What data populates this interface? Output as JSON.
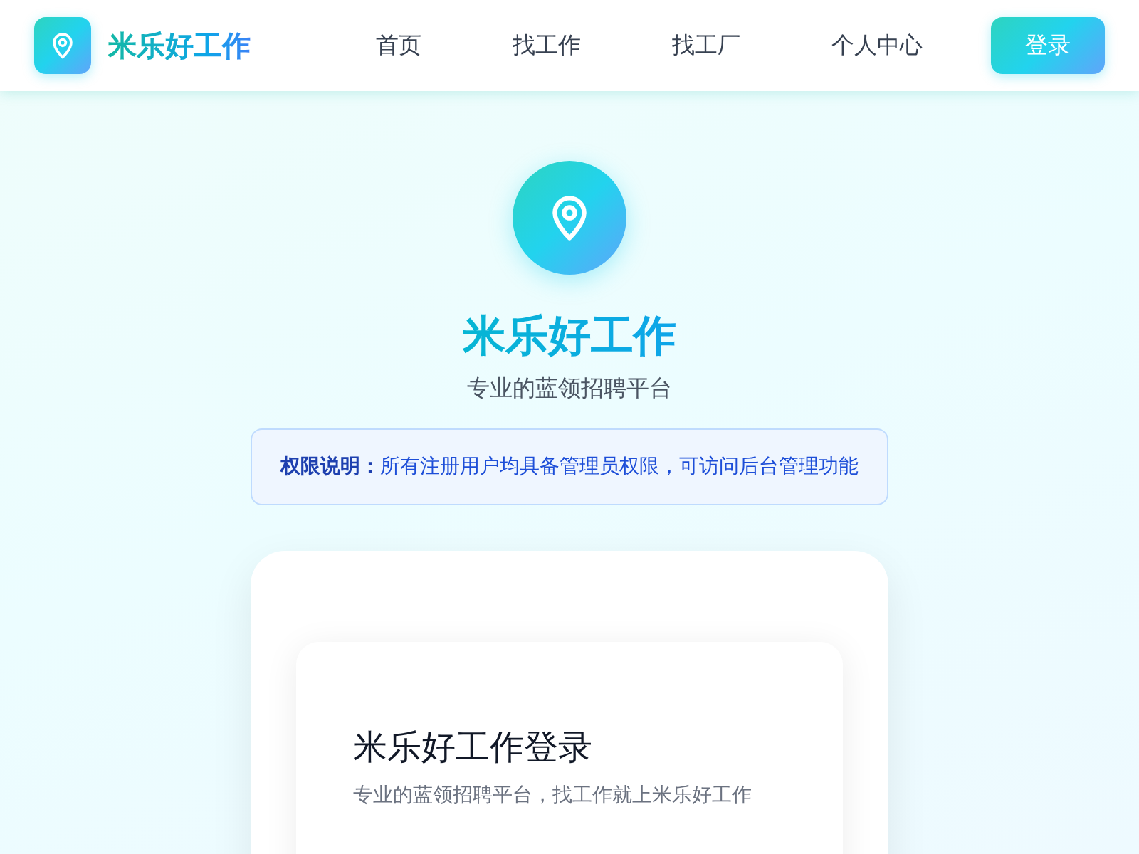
{
  "header": {
    "brand": "米乐好工作",
    "nav": [
      {
        "label": "首页"
      },
      {
        "label": "找工作"
      },
      {
        "label": "找工厂"
      },
      {
        "label": "个人中心"
      }
    ],
    "login_button": "登录"
  },
  "hero": {
    "title": "米乐好工作",
    "subtitle": "专业的蓝领招聘平台",
    "notice": "**权限说明：**所有注册用户均具备管理员权限，可访问后台管理功能"
  },
  "login_card": {
    "title": "米乐好工作登录",
    "subtitle": "专业的蓝领招聘平台，找工作就上米乐好工作"
  }
}
